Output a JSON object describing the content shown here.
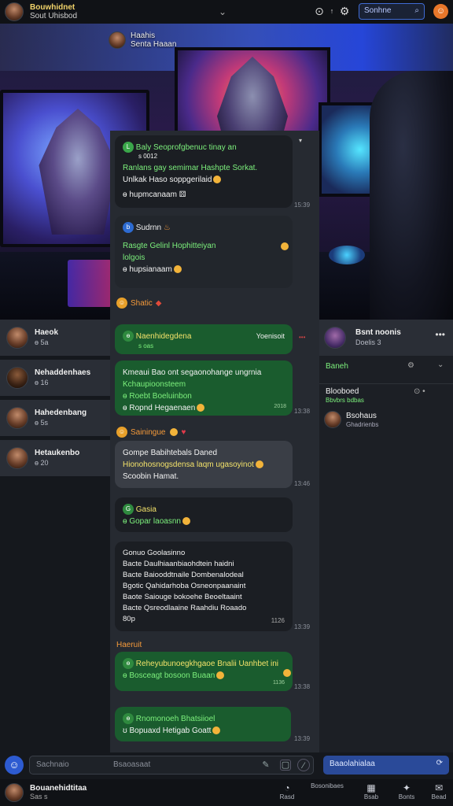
{
  "topbar": {
    "user_name": "Bouwhidnet",
    "user_status": "Sout Uhisbod",
    "chevron": "⌄",
    "timer_icon": "clock-icon",
    "settings_icon": "gear-icon",
    "search_placeholder": "Sonhne",
    "search_icon": "search-icon",
    "notify_icon": "☺"
  },
  "nametag": {
    "line1": "Haahis",
    "line2": "Senta Haaan"
  },
  "contacts": [
    {
      "name": "Haeok",
      "sub": "ɵ 5a"
    },
    {
      "name": "Nehaddenhaes",
      "sub": "ɵ 16"
    },
    {
      "name": "Hahedenbang",
      "sub": "ɵ 5s"
    },
    {
      "name": "Hetaukenbo",
      "sub": "ɵ 20"
    }
  ],
  "chat": {
    "m1": {
      "lines": [
        "Baly Seoprofgbenuc tinay an",
        "Ranlans gay semimar Hashpte Sorkat.",
        "Unlkak Haso soppgerilaid",
        "hupmcanaam"
      ],
      "small": "s 0012",
      "time": "15:39"
    },
    "m2": {
      "head": "Sudrnn",
      "lines": [
        "Rasgte Gelinl Hophitteiyan",
        "lolgois",
        "hupsianaam"
      ]
    },
    "sec1": "Shatic",
    "m3": {
      "title": "Naenhidegdena",
      "right": "Yoenisoit",
      "small": "s oas"
    },
    "m4": {
      "lines": [
        "Kmeaui Bao ont segaonohange ungrnia",
        "Kchaupioonsteem",
        "Roebt Boeluinbon",
        "Ropnd Hegaenaen"
      ],
      "time": "13:38",
      "small": "2018"
    },
    "sec2": "Sainingue",
    "m5": {
      "lines": [
        "Gompe Babihtebals Daned",
        "Hionohosnogsdensa laqm ugasoyinot",
        "Scoobin Hamat."
      ],
      "time": "13:46"
    },
    "m6": {
      "title": "Gasia",
      "line": "Gopar laoasnn"
    },
    "m7": {
      "lines": [
        "Gonuo Goolasinno",
        "Bacte Daulhiaanbiaohdtein haidni",
        "Bacte Baiooddtnaile Dombenalodeal",
        "Bgotic Qahidarhoba Osneonpaanaint",
        "Baote Saiouge bokoehe Beoeltaaint",
        "Bacte Qsreodlaaine Raahdiu Roaado",
        "80p"
      ],
      "time": "13:39",
      "small": "1126"
    },
    "sec3": "Haeruit",
    "m8": {
      "line1": "Reheyubunoegkhgaoe Bnalii Uanhbet ini",
      "line2": "Bosceagt bosoon Buaan",
      "small": "1136",
      "time": "13:38"
    },
    "m9": {
      "line1": "Rnomonoeh Bhatsiioel",
      "line2": "Bopuaxd Hetigab Goatt",
      "time": "13:39"
    }
  },
  "rpanel": {
    "title": "Bsnt noonis",
    "sub": "Doelis 3",
    "row1": "Baneh",
    "row2a": "Blooboed",
    "row2b": "Bbvbrs bdbas",
    "row3a": "Bsohaus",
    "row3b": "Ghadrienbs"
  },
  "composer": {
    "placeholder": "Sachnaio",
    "hint": "Bsaoasaat",
    "right_search": "Baaolahialaa"
  },
  "bottombar": {
    "user_name": "Bouanehidtitaa",
    "user_sub": "Sas s",
    "nav": [
      {
        "label": "Rasd",
        "glyph": "◔"
      },
      {
        "label": "Bosonibaes",
        "glyph": ""
      },
      {
        "label": "Bsab",
        "glyph": "▦"
      },
      {
        "label": "Bonts",
        "glyph": "✦"
      },
      {
        "label": "Bead",
        "glyph": "✉"
      }
    ]
  },
  "colors": {
    "accent": "#2d5bd1",
    "green_bubble": "#1a5c2e",
    "green_text": "#7cf07c",
    "yellow_text": "#f3e26a",
    "orange": "#e8772a"
  }
}
